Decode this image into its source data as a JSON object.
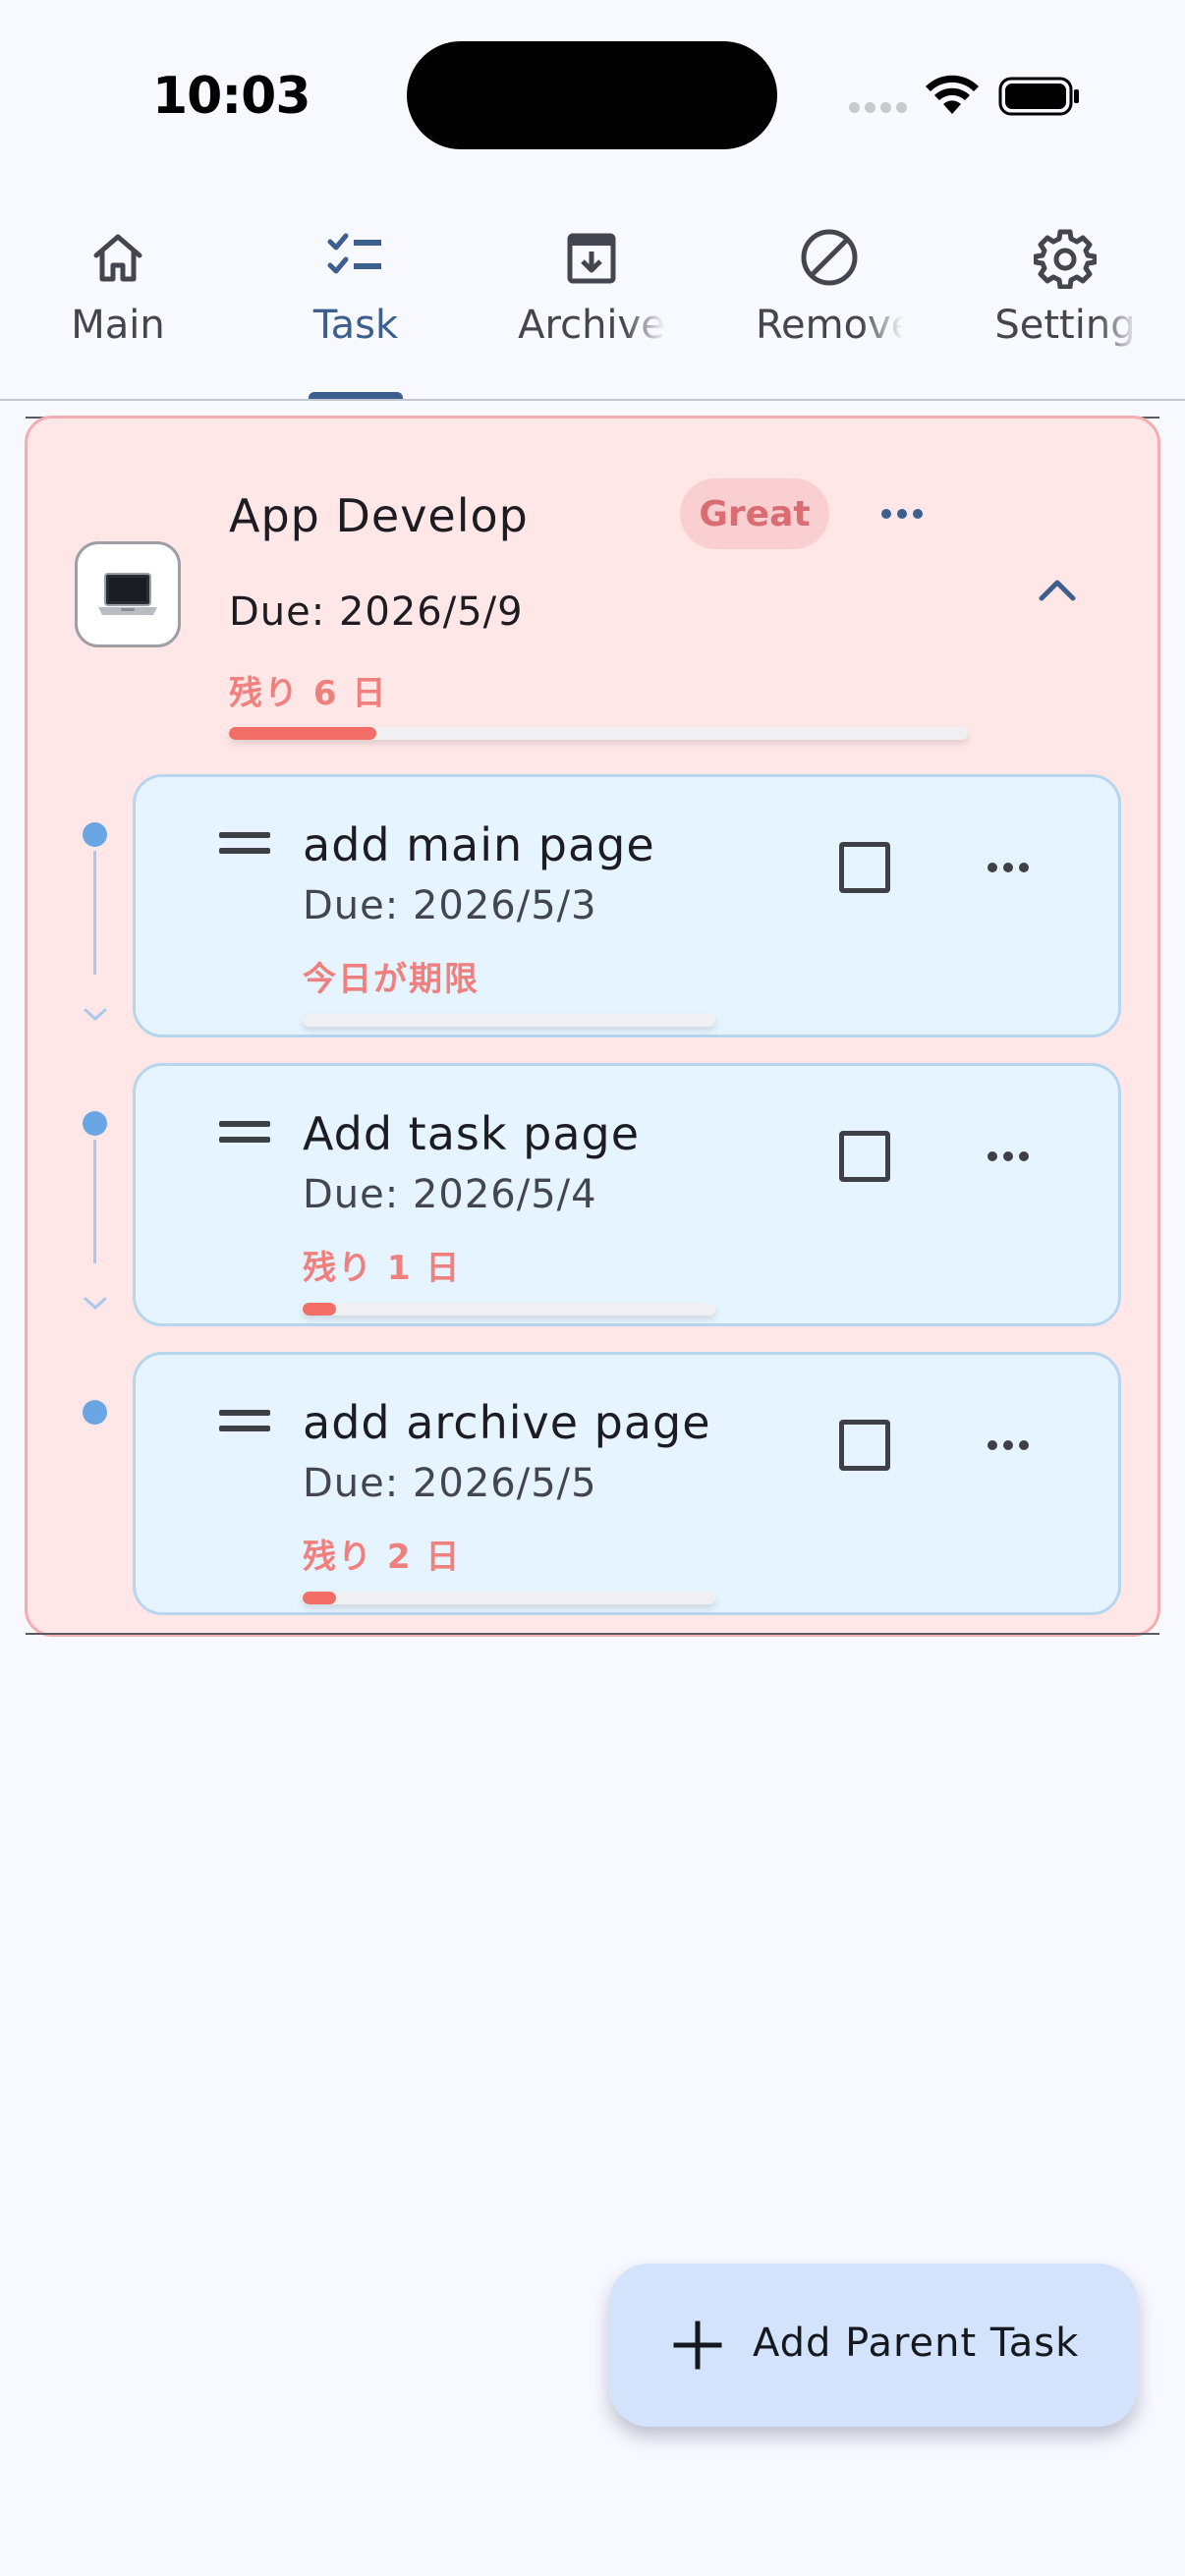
{
  "status_bar": {
    "time": "10:03"
  },
  "tabs": [
    {
      "label": "Main",
      "icon": "home-icon",
      "active": false
    },
    {
      "label": "Task",
      "icon": "checklist-icon",
      "active": true
    },
    {
      "label": "Archive",
      "icon": "archive-icon",
      "active": false
    },
    {
      "label": "Remove",
      "icon": "block-icon",
      "active": false
    },
    {
      "label": "Setting",
      "icon": "gear-icon",
      "active": false
    }
  ],
  "parent_task": {
    "avatar_icon": "laptop-icon",
    "title": "App Develop",
    "badge": "Great",
    "due": "Due: 2026/5/9",
    "remaining": "残り 6 日",
    "progress": 0.2,
    "expanded": true
  },
  "subtasks": [
    {
      "title": "add main page",
      "due": "Due: 2026/5/3",
      "remaining": "今日が期限",
      "progress": 0.0,
      "checked": false
    },
    {
      "title": "Add task page",
      "due": "Due: 2026/5/4",
      "remaining": "残り 1 日",
      "progress": 0.08,
      "checked": false
    },
    {
      "title": "add archive page",
      "due": "Due: 2026/5/5",
      "remaining": "残り 2 日",
      "progress": 0.08,
      "checked": false
    }
  ],
  "fab": {
    "label": "Add Parent Task"
  },
  "colors": {
    "accent": "#3d5f8d",
    "parent_card_bg": "#ffe7e7",
    "subtask_card_bg": "#e6f4ff",
    "remaining_text": "#f0807d",
    "progress_fill": "#f26d66",
    "fab_bg": "#d3e3fb"
  }
}
